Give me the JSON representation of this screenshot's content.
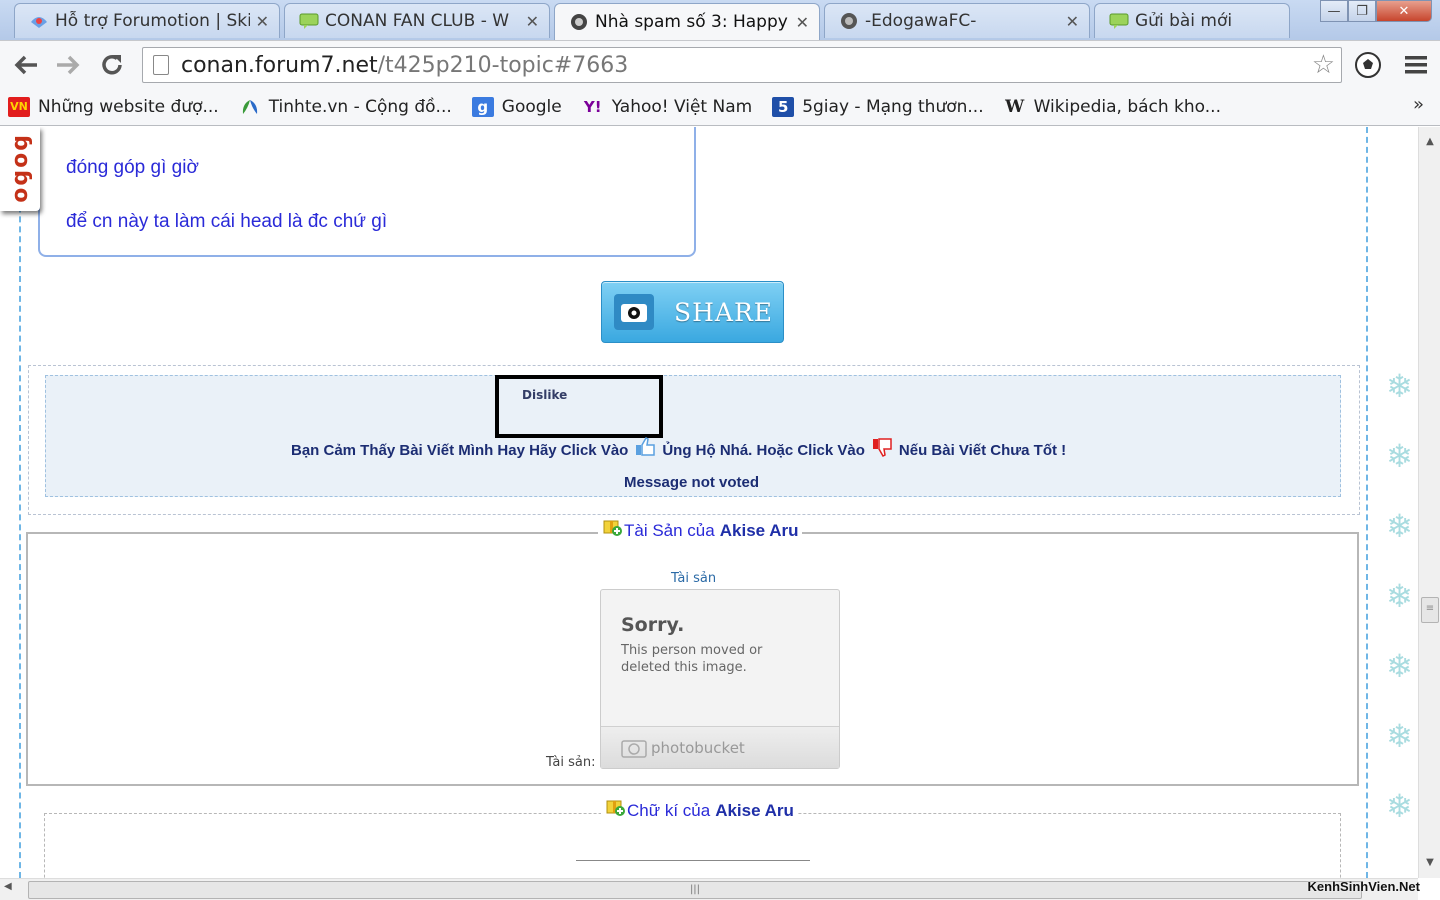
{
  "tabs": [
    {
      "title": "Hỗ trợ Forumotion | Ski",
      "icon": "forumotion-icon"
    },
    {
      "title": "CONAN FAN CLUB - W",
      "icon": "chat-bubble-icon"
    },
    {
      "title": "Nhà spam số 3: Happy",
      "icon": "avatar-icon"
    },
    {
      "title": "-EdogawaFC-",
      "icon": "avatar-icon"
    },
    {
      "title": "Gửi bài mới",
      "icon": "chat-bubble-icon"
    }
  ],
  "address": {
    "host": "conan.forum7.net",
    "path": "/t425p210-topic#7663"
  },
  "bookmarks": [
    {
      "label": "Những website đượ...",
      "icon": "vn-icon"
    },
    {
      "label": "Tinhte.vn - Cộng đồ...",
      "icon": "tinhte-icon"
    },
    {
      "label": "Google",
      "icon": "google-icon"
    },
    {
      "label": "Yahoo! Việt Nam",
      "icon": "yahoo-icon"
    },
    {
      "label": "5giay - Mạng thươn...",
      "icon": "5giay-icon"
    },
    {
      "label": "Wikipedia, bách kho...",
      "icon": "wikipedia-icon"
    }
  ],
  "bookmarks_more": "»",
  "sidetag": "ɓoɓo",
  "quote": {
    "line1": "đóng góp gì giờ",
    "line2": "để cn này ta làm cái head là đc chứ gì"
  },
  "share_label": "SHARE",
  "rating": {
    "dislike_label": "Dislike",
    "text_before": "Bạn Cảm Thấy Bài Viết Mình Hay Hãy Click Vào",
    "text_middle": "Ủng Hộ Nhá. Hoặc Click Vào",
    "text_after": "Nếu Bài Viết Chưa Tốt !",
    "status": "Message not voted"
  },
  "assets": {
    "legend_prefix": "Tài Sản của",
    "username": "Akise Aru",
    "label_top": "Tài sản",
    "label_bottom": "Tài sản:",
    "image_title": "Sorry.",
    "image_message": "This person moved or deleted this image.",
    "image_brand": "photobucket"
  },
  "signature": {
    "legend_prefix": "Chữ kí của",
    "username": "Akise Aru"
  },
  "watermark": "KenhSinhVien.Net",
  "colors": {
    "link_blue": "#2a2ad8",
    "share_blue": "#3aa8e0",
    "rate_bg": "#eaf1f8"
  }
}
